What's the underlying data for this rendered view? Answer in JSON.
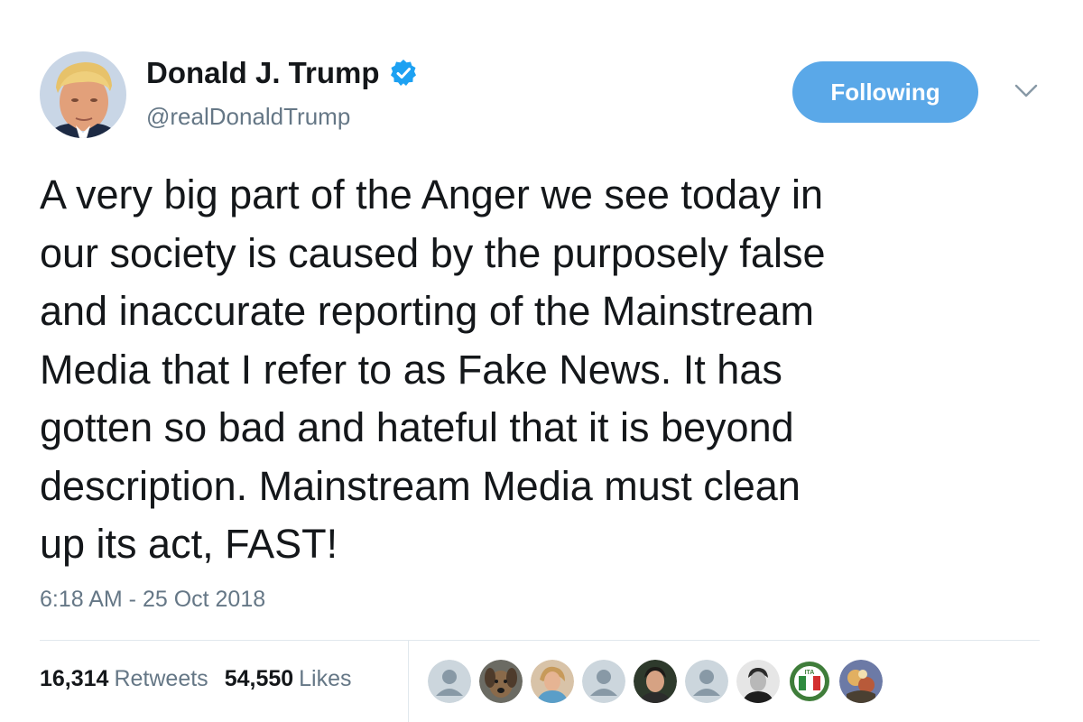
{
  "author": {
    "display_name": "Donald J. Trump",
    "handle": "@realDonaldTrump",
    "verified": true,
    "verified_icon": "verified-badge-icon",
    "accent_color": "#1da1f2"
  },
  "actions": {
    "follow_label": "Following",
    "follow_color": "#5aa8e8",
    "menu_icon": "chevron-down-icon"
  },
  "tweet": {
    "lines": [
      "A very big part of the Anger we see today in",
      "our society is caused by the purposely false",
      "and inaccurate reporting of the Mainstream",
      "Media that I refer to as Fake News. It has",
      "gotten so bad and hateful that it is beyond",
      "description. Mainstream Media must clean",
      "up its act, FAST!"
    ],
    "timestamp": "6:18 AM - 25 Oct 2018"
  },
  "stats": {
    "retweets_count": "16,314",
    "retweets_label": "Retweets",
    "likes_count": "54,550",
    "likes_label": "Likes"
  },
  "likers": [
    {
      "type": "default-avatar"
    },
    {
      "type": "photo-avatar"
    },
    {
      "type": "photo-avatar"
    },
    {
      "type": "default-avatar"
    },
    {
      "type": "photo-avatar"
    },
    {
      "type": "default-avatar"
    },
    {
      "type": "photo-avatar"
    },
    {
      "type": "flag-badge-avatar",
      "text": "ITA"
    },
    {
      "type": "photo-avatar"
    }
  ]
}
